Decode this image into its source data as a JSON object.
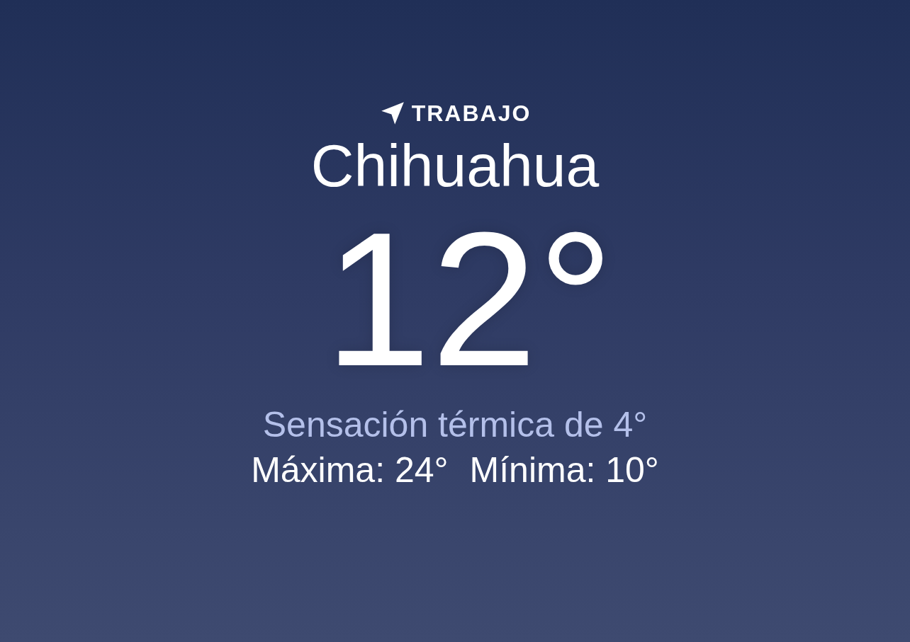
{
  "location": {
    "label": "TRABAJO",
    "is_current": true
  },
  "city": "Chihuahua",
  "temperature": "12°",
  "feels_like": "Sensación térmica de 4°",
  "high": "Máxima: 24°",
  "low": "Mínima: 10°"
}
